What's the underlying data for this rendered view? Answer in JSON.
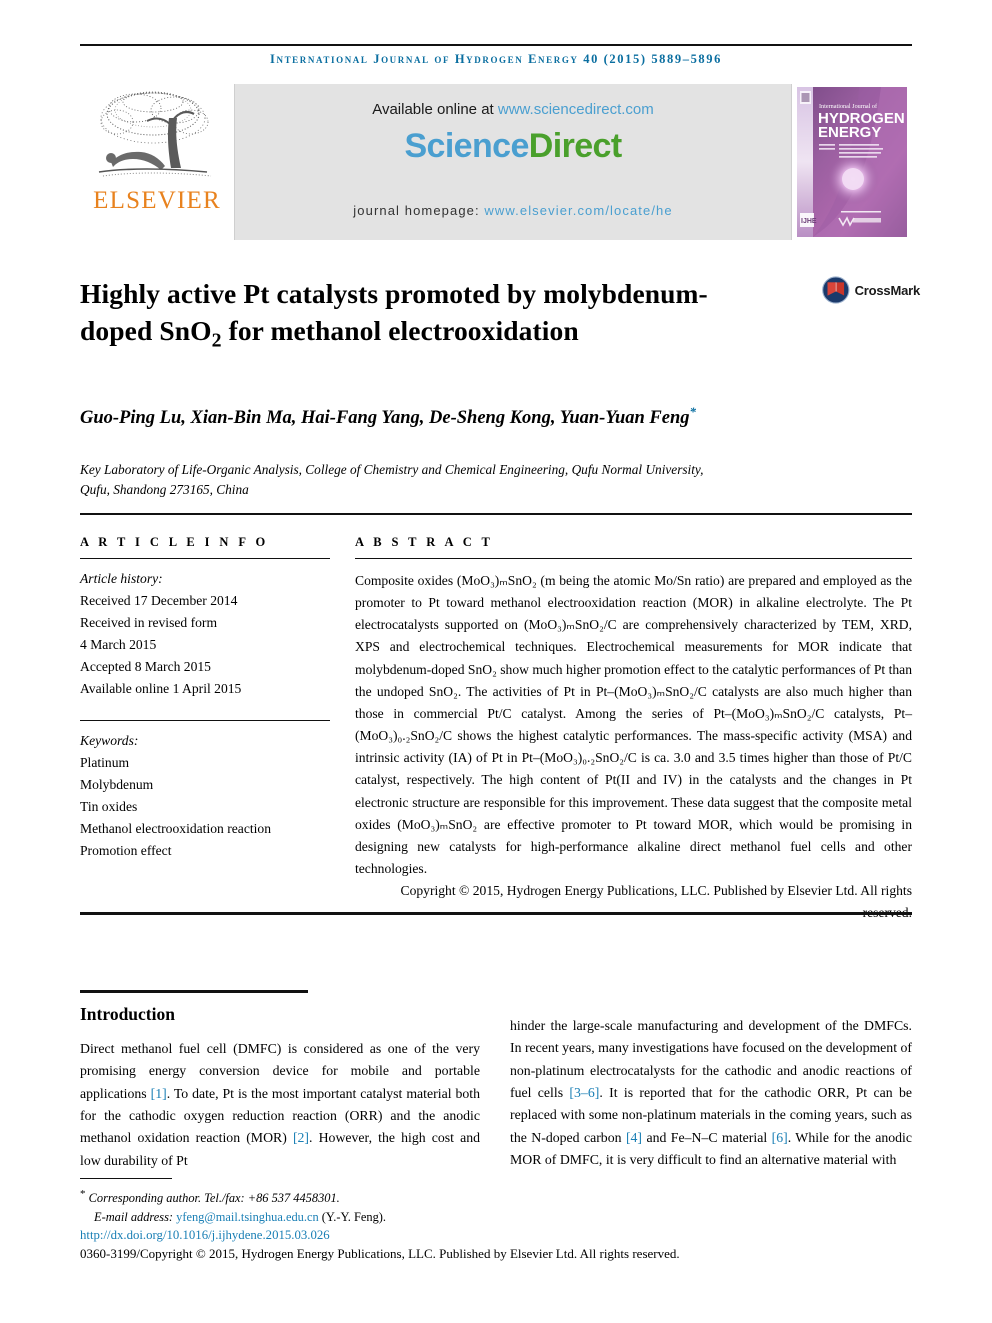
{
  "running_head": "International Journal of Hydrogen Energy 40 (2015) 5889–5896",
  "colors": {
    "journal_blue": "#0a6ea0",
    "link_blue": "#4a9fd0",
    "ref_blue": "#1a7fb5",
    "sciencedirect_green": "#4aa02c",
    "elsevier_orange": "#e8821e",
    "panel_gray": "#e3e3e3"
  },
  "masthead": {
    "publisher_name": "ELSEVIER",
    "available_prefix": "Available online at ",
    "available_url": "www.sciencedirect.com",
    "logo_part1": "Science",
    "logo_part2": "Direct",
    "homepage_prefix": "journal homepage: ",
    "homepage_url": "www.elsevier.com/locate/he",
    "cover": {
      "line1": "International Journal of",
      "line2": "HYDROGEN",
      "line3": "ENERGY",
      "editor_lines": "Editor-in-Chief: T. Nejat Veziroğlu   Associate Editors: A. Hashimi, D.L. Stojić, S.A. Sherif, A.E. Mansha, J.W. Sheffield, J.-c. Bart and D.A. Stolten",
      "footer_logo": "ScienceDirect",
      "corner_badge": "IJHE"
    }
  },
  "crossmark": {
    "label": "CrossMark"
  },
  "article": {
    "title": "Highly active Pt catalysts promoted by molybdenum-doped SnO₂ for methanol electrooxidation",
    "authors": "Guo-Ping Lu, Xian-Bin Ma, Hai-Fang Yang, De-Sheng Kong, Yuan-Yuan Feng",
    "corresponding_marker": "*",
    "affiliation_line1": "Key Laboratory of Life-Organic Analysis, College of Chemistry and Chemical Engineering, Qufu Normal University,",
    "affiliation_line2": "Qufu, Shandong 273165, China"
  },
  "article_info": {
    "heading": "A R T I C L E   I N F O",
    "history_label": "Article history:",
    "history": [
      "Received 17 December 2014",
      "Received in revised form",
      "4 March 2015",
      "Accepted 8 March 2015",
      "Available online 1 April 2015"
    ],
    "keywords_label": "Keywords:",
    "keywords": [
      "Platinum",
      "Molybdenum",
      "Tin oxides",
      "Methanol electrooxidation reaction",
      "Promotion effect"
    ]
  },
  "abstract": {
    "heading": "A B S T R A C T",
    "body": "Composite oxides (MoO₃)ₘSnO₂ (m being the atomic Mo/Sn ratio) are prepared and employed as the promoter to Pt toward methanol electrooxidation reaction (MOR) in alkaline electrolyte. The Pt electrocatalysts supported on (MoO₃)ₘSnO₂/C are comprehensively characterized by TEM, XRD, XPS and electrochemical techniques. Electrochemical measurements for MOR indicate that molybdenum-doped SnO₂ show much higher promotion effect to the catalytic performances of Pt than the undoped SnO₂. The activities of Pt in Pt–(MoO₃)ₘSnO₂/C catalysts are also much higher than those in commercial Pt/C catalyst. Among the series of Pt–(MoO₃)ₘSnO₂/C catalysts, Pt–(MoO₃)₀.₂SnO₂/C shows the highest catalytic performances. The mass-specific activity (MSA) and intrinsic activity (IA) of Pt in Pt–(MoO₃)₀.₂SnO₂/C is ca. 3.0 and 3.5 times higher than those of Pt/C catalyst, respectively. The high content of Pt(II and IV) in the catalysts and the changes in Pt electronic structure are responsible for this improvement. These data suggest that the composite metal oxides (MoO₃)ₘSnO₂ are effective promoter to Pt toward MOR, which would be promising in designing new catalysts for high-performance alkaline direct methanol fuel cells and other technologies.",
    "copyright": "Copyright © 2015, Hydrogen Energy Publications, LLC. Published by Elsevier Ltd. All rights reserved."
  },
  "introduction": {
    "heading": "Introduction",
    "left_paragraph_parts": [
      "Direct methanol fuel cell (DMFC) is considered as one of the very promising energy conversion device for mobile and portable applications ",
      "[1]",
      ". To date, Pt is the most important catalyst material both for the cathodic oxygen reduction reaction (ORR) and the anodic methanol oxidation reaction (MOR) ",
      "[2]",
      ". However, the high cost and low durability of Pt"
    ],
    "right_paragraph_parts": [
      "hinder the large-scale manufacturing and development of the DMFCs. In recent years, many investigations have focused on the development of non-platinum electrocatalysts for the cathodic and anodic reactions of fuel cells ",
      "[3–6]",
      ". It is reported that for the cathodic ORR, Pt can be replaced with some non-platinum materials in the coming years, such as the N-doped carbon ",
      "[4]",
      " and Fe–N–C material ",
      "[6]",
      ". While for the anodic MOR of DMFC, it is very difficult to find an alternative material with"
    ]
  },
  "footer": {
    "corresponding_star": "*",
    "corresponding_text": "Corresponding author. Tel./fax: +86 537 4458301.",
    "email_label": "E-mail address: ",
    "email": "yfeng@mail.tsinghua.edu.cn",
    "email_suffix": " (Y.-Y. Feng).",
    "doi": "http://dx.doi.org/10.1016/j.ijhydene.2015.03.026",
    "issn_line": "0360-3199/Copyright © 2015, Hydrogen Energy Publications, LLC. Published by Elsevier Ltd. All rights reserved."
  }
}
